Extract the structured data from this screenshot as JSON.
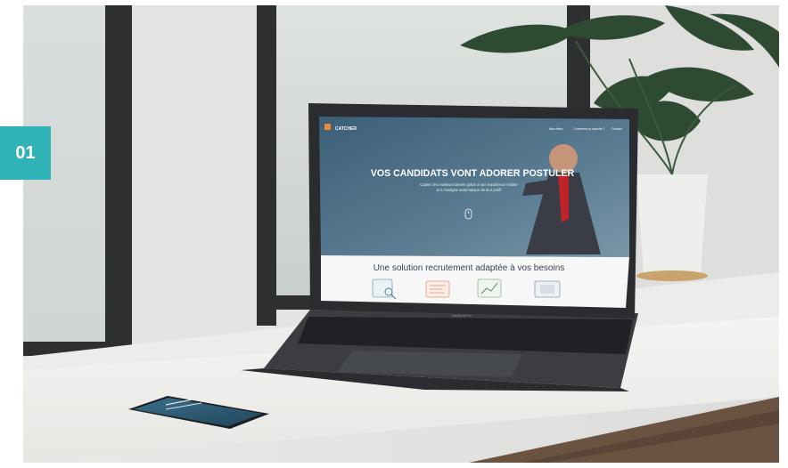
{
  "badge": {
    "number": "01"
  },
  "website": {
    "logo_text": "CATCHER",
    "nav": [
      "Nos offres",
      "Comment ça marche ?",
      "Contact"
    ],
    "hero_title": "VOS CANDIDATS VONT ADORER POSTULER",
    "hero_subtitle_line1": "Captez les meilleurs talents grâce à une expérience inédite",
    "hero_subtitle_line2": "et à l'analyse automatique de leur profil",
    "section_title": "Une solution recrutement adaptée à vos besoins",
    "feature_icons": [
      "search-documents-icon",
      "cv-document-icon",
      "chart-growth-icon",
      "screens-icon"
    ]
  },
  "laptop": {
    "model_label": "MacBook Pro"
  },
  "colors": {
    "accent": "#2fb3b6",
    "hero_overlay": "#4b6f86",
    "section_title": "#3a4552"
  }
}
